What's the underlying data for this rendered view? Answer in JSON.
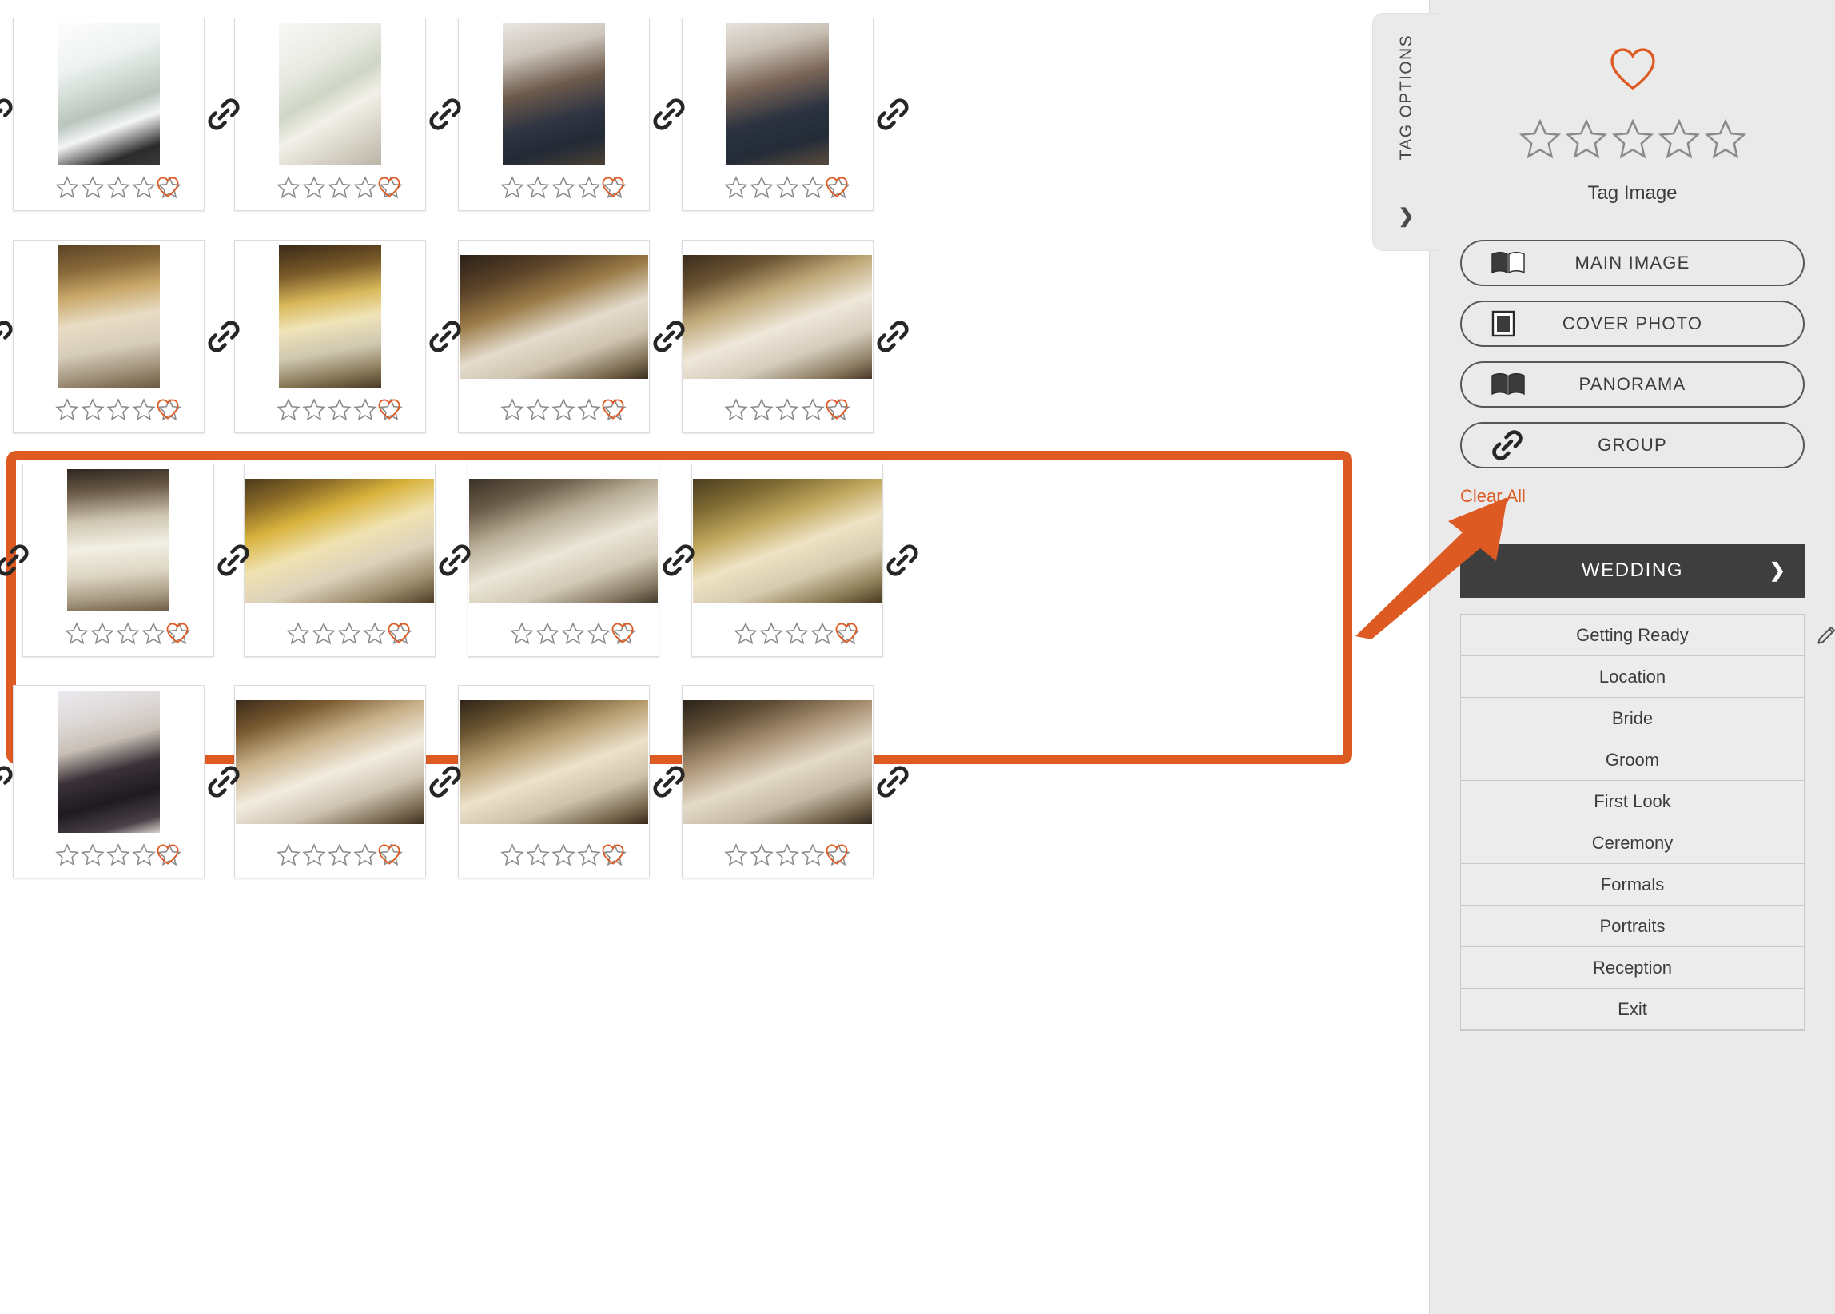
{
  "panel": {
    "tab_label": "TAG OPTIONS",
    "tab_chevron": "❯",
    "favorite_icon": "heart-icon",
    "rating_stars": 5,
    "rating_value": 0,
    "tag_image_label": "Tag Image",
    "buttons": [
      {
        "label": "MAIN IMAGE",
        "icon": "open-book-icon"
      },
      {
        "label": "COVER PHOTO",
        "icon": "framed-photo-icon"
      },
      {
        "label": "PANORAMA",
        "icon": "panorama-book-icon"
      },
      {
        "label": "GROUP",
        "icon": "chain-link-icon"
      }
    ],
    "clear_all_label": "Clear All",
    "category_header": {
      "title": "WEDDING",
      "chevron": "❯"
    },
    "categories": [
      "Getting Ready",
      "Location",
      "Bride",
      "Groom",
      "First Look",
      "Ceremony",
      "Formals",
      "Portraits",
      "Reception",
      "Exit"
    ],
    "edit_icon": "pencil-edit-icon"
  },
  "colors": {
    "accent_orange": "#DE5A23",
    "panel_bg": "#EAEAEA",
    "header_dark": "#3E3E3E",
    "star_outline": "#8a8a8a",
    "card_border": "#dcdcdc"
  },
  "grid": {
    "columns": 4,
    "rows": 4,
    "rating_stars_per_card": 5,
    "link_icon": "chain-link-icon",
    "favorite_icon": "heart-icon",
    "selected_row_index": 2,
    "cards": [
      {
        "rating": 0,
        "favorited": false,
        "orientation": "portrait",
        "caption": "bride-in-white-atrium"
      },
      {
        "rating": 0,
        "favorited": false,
        "orientation": "portrait",
        "caption": "bride-by-window"
      },
      {
        "rating": 0,
        "favorited": false,
        "orientation": "portrait",
        "caption": "couple-embrace-portrait"
      },
      {
        "rating": 0,
        "favorited": false,
        "orientation": "portrait",
        "caption": "couple-facing-portrait"
      },
      {
        "rating": 0,
        "favorited": false,
        "orientation": "portrait",
        "caption": "reception-table-setting"
      },
      {
        "rating": 0,
        "favorited": false,
        "orientation": "portrait",
        "caption": "branch-centerpieces"
      },
      {
        "rating": 0,
        "favorited": false,
        "orientation": "landscape",
        "caption": "couple-in-hall"
      },
      {
        "rating": 0,
        "favorited": false,
        "orientation": "landscape",
        "caption": "bride-in-ballroom"
      },
      {
        "rating": 0,
        "favorited": false,
        "orientation": "portrait",
        "caption": "floral-table-detail"
      },
      {
        "rating": 0,
        "favorited": false,
        "orientation": "landscape",
        "caption": "reception-room-yellow"
      },
      {
        "rating": 0,
        "favorited": false,
        "orientation": "landscape",
        "caption": "reception-windows"
      },
      {
        "rating": 0,
        "favorited": false,
        "orientation": "landscape",
        "caption": "reception-wide-wood"
      },
      {
        "rating": 0,
        "favorited": false,
        "orientation": "portrait",
        "caption": "monogram-box-detail"
      },
      {
        "rating": 0,
        "favorited": false,
        "orientation": "landscape",
        "caption": "first-dance-drapes"
      },
      {
        "rating": 0,
        "favorited": false,
        "orientation": "landscape",
        "caption": "first-dance-guests"
      },
      {
        "rating": 0,
        "favorited": false,
        "orientation": "landscape",
        "caption": "couple-dancing-crowd"
      }
    ]
  },
  "annotation": {
    "type": "arrow",
    "color": "#DE5A23",
    "points_to": "GROUP"
  }
}
